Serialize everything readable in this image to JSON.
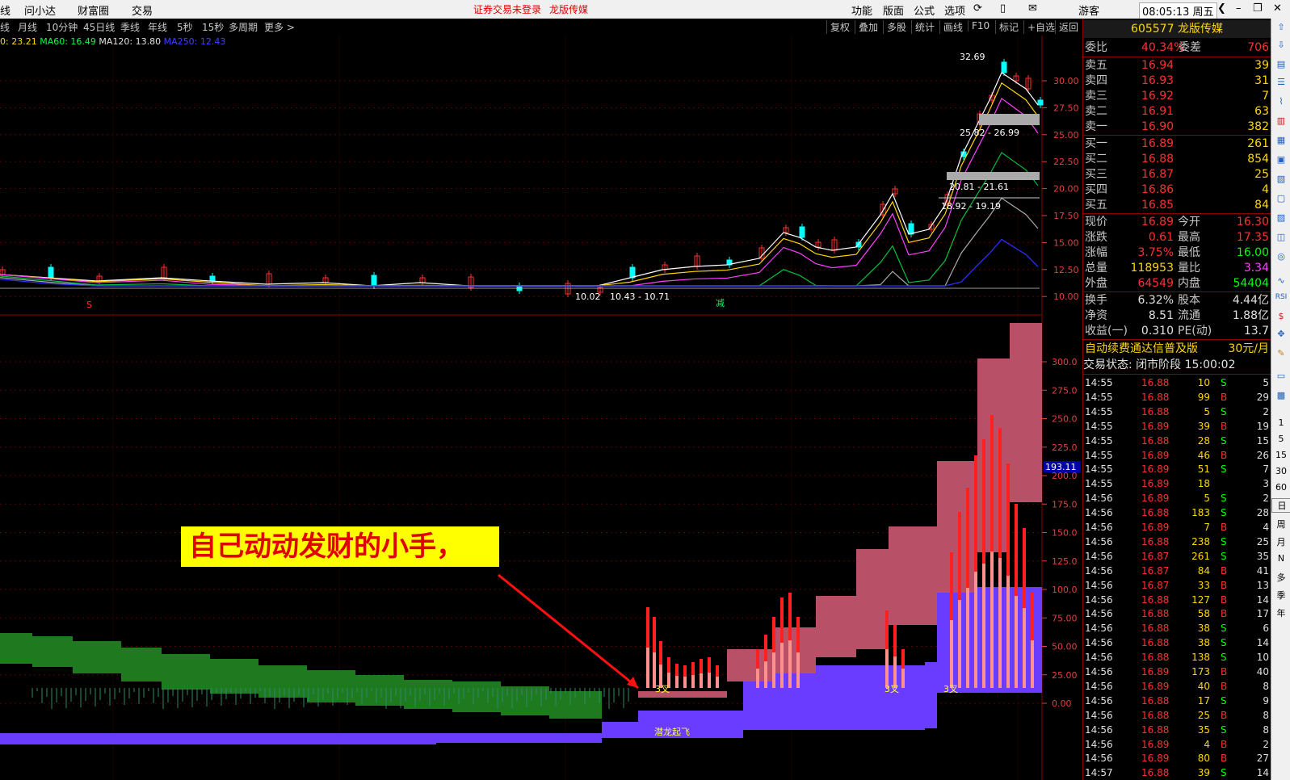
{
  "titlebar": {
    "left_tabs": [
      "线",
      "问小达",
      "财富圈",
      "交易"
    ],
    "notice": "证券交易未登录",
    "stock_name": "龙版传媒",
    "menu": [
      "功能",
      "版面",
      "公式",
      "选项"
    ],
    "user": "游客",
    "clock": "08:05:13 周五"
  },
  "period_bar": {
    "items": [
      "线",
      "月线",
      "10分钟",
      "45日线",
      "季线",
      "年线",
      "5秒",
      "15秒",
      "多周期",
      "更多 >"
    ],
    "right_buttons": [
      "复权",
      "叠加",
      "多股",
      "统计",
      "画线",
      "F10",
      "标记",
      "+自选",
      "返回"
    ]
  },
  "ma": {
    "ma30": "0: 23.21",
    "ma60": "MA60: 16.49",
    "ma120": "MA120: 13.80",
    "ma250": "MA250: 12.43"
  },
  "price_axis": [
    "30.00",
    "27.50",
    "25.00",
    "22.50",
    "20.00",
    "17.50",
    "15.00",
    "12.50",
    "10.00"
  ],
  "indicator_axis": [
    "300.0",
    "275.0",
    "250.0",
    "225.0",
    "200.0",
    "175.0",
    "150.0",
    "125.0",
    "100.0",
    "75.00",
    "50.00",
    "25.00",
    "0.00"
  ],
  "indicator_current": "193.11",
  "chart_labels": {
    "high": "32.69",
    "zone1": "25.82 - 26.99",
    "zone2": "20.81 - 21.61",
    "zone3": "18.92 - 19.19",
    "low": "10.02",
    "zone_low": "10.43 - 10.71",
    "s_mark": "S",
    "jian": "减",
    "marker_text": "潜龙起飞",
    "cross1": "3叉",
    "cross2": "3叉",
    "cross3": "3叉"
  },
  "banner": "自己动动发财的小手，",
  "quote": {
    "code_name": "605577 龙版传媒",
    "weibi": {
      "label": "委比",
      "value": "40.34%",
      "label2": "委差",
      "value2": "706"
    },
    "sells": [
      {
        "label": "卖五",
        "price": "16.94",
        "vol": "39"
      },
      {
        "label": "卖四",
        "price": "16.93",
        "vol": "31"
      },
      {
        "label": "卖三",
        "price": "16.92",
        "vol": "7"
      },
      {
        "label": "卖二",
        "price": "16.91",
        "vol": "63"
      },
      {
        "label": "卖一",
        "price": "16.90",
        "vol": "382"
      }
    ],
    "buys": [
      {
        "label": "买一",
        "price": "16.89",
        "vol": "261"
      },
      {
        "label": "买二",
        "price": "16.88",
        "vol": "854"
      },
      {
        "label": "买三",
        "price": "16.87",
        "vol": "25"
      },
      {
        "label": "买四",
        "price": "16.86",
        "vol": "4"
      },
      {
        "label": "买五",
        "price": "16.85",
        "vol": "84"
      }
    ],
    "stats": [
      {
        "l1": "现价",
        "v1": "16.89",
        "l2": "今开",
        "v2": "16.30"
      },
      {
        "l1": "涨跌",
        "v1": "0.61",
        "l2": "最高",
        "v2": "17.35"
      },
      {
        "l1": "涨幅",
        "v1": "3.75%",
        "l2": "最低",
        "v2": "16.00"
      },
      {
        "l1": "总量",
        "v1": "118953",
        "l2": "量比",
        "v2": "3.34"
      },
      {
        "l1": "外盘",
        "v1": "64549",
        "l2": "内盘",
        "v2": "54404"
      }
    ],
    "stats2": [
      {
        "l1": "换手",
        "v1": "6.32%",
        "l2": "股本",
        "v2": "4.44亿"
      },
      {
        "l1": "净资",
        "v1": "8.51",
        "l2": "流通",
        "v2": "1.88亿"
      },
      {
        "l1": "收益(一)",
        "v1": "0.310",
        "l2": "PE(动)",
        "v2": "13.7"
      }
    ],
    "promo": "自动续费通达信普及版",
    "promo_price": "30元/月",
    "status": "交易状态: 闭市阶段 15:00:02",
    "ticks": [
      {
        "t": "14:55",
        "p": "16.88",
        "v": "10",
        "d": "S",
        "n": "5"
      },
      {
        "t": "14:55",
        "p": "16.88",
        "v": "99",
        "d": "B",
        "n": "29"
      },
      {
        "t": "14:55",
        "p": "16.88",
        "v": "5",
        "d": "S",
        "n": "2"
      },
      {
        "t": "14:55",
        "p": "16.89",
        "v": "39",
        "d": "B",
        "n": "19"
      },
      {
        "t": "14:55",
        "p": "16.88",
        "v": "28",
        "d": "S",
        "n": "15"
      },
      {
        "t": "14:55",
        "p": "16.89",
        "v": "46",
        "d": "B",
        "n": "26"
      },
      {
        "t": "14:55",
        "p": "16.89",
        "v": "51",
        "d": "S",
        "n": "7"
      },
      {
        "t": "14:55",
        "p": "16.89",
        "v": "18",
        "d": "",
        "n": "3"
      },
      {
        "t": "14:56",
        "p": "16.89",
        "v": "5",
        "d": "S",
        "n": "2"
      },
      {
        "t": "14:56",
        "p": "16.88",
        "v": "183",
        "d": "S",
        "n": "28"
      },
      {
        "t": "14:56",
        "p": "16.89",
        "v": "7",
        "d": "B",
        "n": "4"
      },
      {
        "t": "14:56",
        "p": "16.88",
        "v": "238",
        "d": "S",
        "n": "25"
      },
      {
        "t": "14:56",
        "p": "16.87",
        "v": "261",
        "d": "S",
        "n": "35"
      },
      {
        "t": "14:56",
        "p": "16.87",
        "v": "84",
        "d": "B",
        "n": "41"
      },
      {
        "t": "14:56",
        "p": "16.87",
        "v": "33",
        "d": "B",
        "n": "13"
      },
      {
        "t": "14:56",
        "p": "16.88",
        "v": "127",
        "d": "B",
        "n": "14"
      },
      {
        "t": "14:56",
        "p": "16.88",
        "v": "58",
        "d": "B",
        "n": "17"
      },
      {
        "t": "14:56",
        "p": "16.88",
        "v": "38",
        "d": "S",
        "n": "6"
      },
      {
        "t": "14:56",
        "p": "16.88",
        "v": "38",
        "d": "S",
        "n": "14"
      },
      {
        "t": "14:56",
        "p": "16.88",
        "v": "138",
        "d": "S",
        "n": "10"
      },
      {
        "t": "14:56",
        "p": "16.89",
        "v": "173",
        "d": "B",
        "n": "40"
      },
      {
        "t": "14:56",
        "p": "16.89",
        "v": "40",
        "d": "B",
        "n": "8"
      },
      {
        "t": "14:56",
        "p": "16.88",
        "v": "17",
        "d": "S",
        "n": "9"
      },
      {
        "t": "14:56",
        "p": "16.88",
        "v": "25",
        "d": "B",
        "n": "8"
      },
      {
        "t": "14:56",
        "p": "16.88",
        "v": "35",
        "d": "S",
        "n": "8"
      },
      {
        "t": "14:56",
        "p": "16.89",
        "v": "4",
        "d": "B",
        "n": "2"
      },
      {
        "t": "14:56",
        "p": "16.89",
        "v": "80",
        "d": "B",
        "n": "27"
      },
      {
        "t": "14:57",
        "p": "16.88",
        "v": "39",
        "d": "S",
        "n": "14"
      }
    ]
  },
  "side_tools": [
    "1",
    "5",
    "15",
    "30",
    "60",
    "日",
    "周",
    "月",
    "N",
    "多",
    "季",
    "年"
  ],
  "colors": {
    "up": "#ff3030",
    "down": "#00ffff",
    "green_cloud": "#1f7a1f",
    "purple_cloud": "#6a3cff",
    "pink_cloud": "#b85068"
  }
}
